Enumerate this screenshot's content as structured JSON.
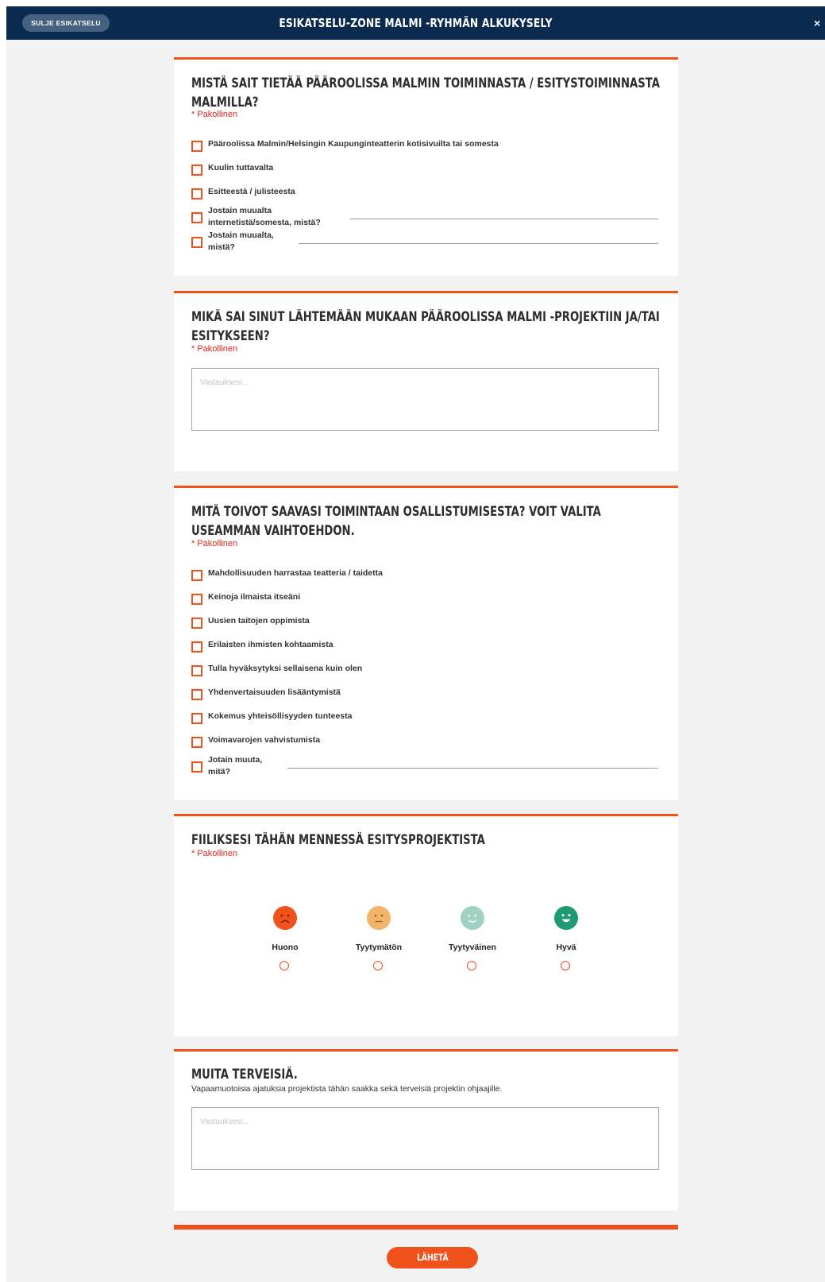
{
  "topbar": {
    "close_preview_label": "SULJE ESIKATSELU",
    "title": "ESIKATSELU-ZONE MALMI -RYHMÄN ALKUKYSELY",
    "close_icon": "close-icon",
    "close_glyph": "×"
  },
  "required_label": "* Pakollinen",
  "q1": {
    "title": "MISTÄ SAIT TIETÄÄ PÄÄROOLISSA MALMIN TOIMINNASTA / ESITYSTOIMINNASTA MALMILLA?",
    "options": [
      "Pääroolissa Malmin/Helsingin Kaupunginteatterin kotisivuilta tai somesta",
      "Kuulin tuttavalta",
      "Esitteestä / julisteesta",
      "Jostain muualta internetistä/somesta, mistä?",
      "Jostain muualta, mistä?"
    ]
  },
  "q2": {
    "title": "MIKÄ SAI SINUT LÄHTEMÄÄN MUKAAN PÄÄROOLISSA MALMI -PROJEKTIIN JA/TAI ESITYKSEEN?",
    "placeholder": "Vastauksesi..."
  },
  "q3": {
    "title": "MITÄ TOIVOT SAAVASI TOIMINTAAN OSALLISTUMISESTA? VOIT VALITA USEAMMAN VAIHTOEHDON.",
    "options": [
      "Mahdollisuuden harrastaa teatteria / taidetta",
      "Keinoja ilmaista itseäni",
      "Uusien taitojen oppimista",
      "Erilaisten ihmisten kohtaamista",
      "Tulla hyväksytyksi sellaisena kuin olen",
      "Yhdenvertaisuuden lisääntymistä",
      "Kokemus yhteisöllisyyden tunteesta",
      "Voimavarojen vahvistumista",
      "Jotain muuta, mitä?"
    ]
  },
  "q4": {
    "title": "FIILIKSESI TÄHÄN MENNESSÄ ESITYSPROJEKTISTA",
    "faces": [
      {
        "label": "Huono",
        "color": "#f0521b",
        "icon": "sad-face-icon"
      },
      {
        "label": "Tyytymätön",
        "color": "#f1b46a",
        "icon": "neutral-face-icon"
      },
      {
        "label": "Tyytyväinen",
        "color": "#9fd2c3",
        "icon": "smile-face-icon"
      },
      {
        "label": "Hyvä",
        "color": "#1f9a73",
        "icon": "happy-face-icon"
      }
    ]
  },
  "q5": {
    "title": "MUITA TERVEISIÄ.",
    "description": "Vapaamuotoisia ajatuksia projektista tähän saakka sekä terveisiä projektin ohjaajille.",
    "placeholder": "Vastauksesi..."
  },
  "submit_label": "LÄHETÄ",
  "colors": {
    "accent": "#f0521b",
    "header": "#0b2a4f",
    "required": "#e0261b"
  }
}
